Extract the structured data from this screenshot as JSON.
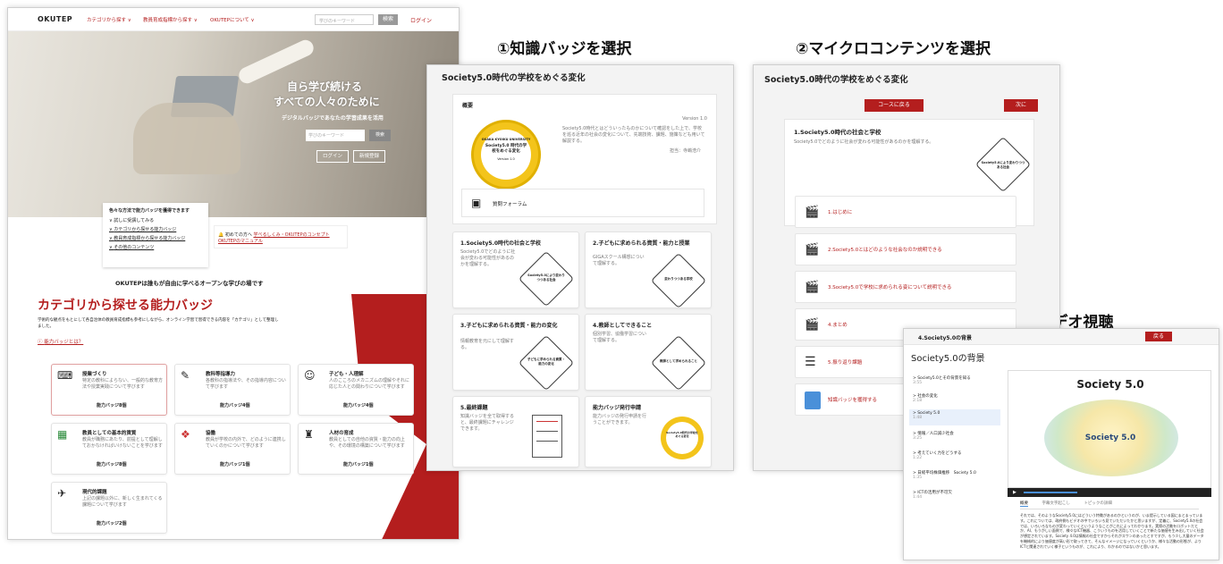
{
  "steps": {
    "s1": "①知識バッジを選択",
    "s2": "②マイクロコンテンツを選択",
    "s3": "③ビデオ視聴"
  },
  "home": {
    "logo": "OKUTEP",
    "nav": [
      "カテゴリから探す ∨",
      "教員育成指標から探す ∨",
      "OKUTEPについて ∨"
    ],
    "search_placeholder": "学びのキーワード",
    "search_btn": "検索",
    "login": "ログイン",
    "hero_title1": "自ら学び続ける",
    "hero_title2": "すべての人々のために",
    "hero_sub": "デジタルバッジであなたの学習成果を活用",
    "hero_search_placeholder": "学びのキーワード",
    "hero_search_btn": "検索",
    "hero_login": "ログイン",
    "hero_register": "新規登録",
    "ways_title": "色々な方法で能力バッジを獲得できます",
    "ways": [
      "試しに受講してみる",
      "カテゴリから探せる能力バッジ",
      "教員育成指標から探せる能力バッジ",
      "その他のコンテンツ"
    ],
    "first_time": "初めての方へ",
    "first_links": "学べるしくみ・OKUTEPのコンセプト OKUTEPのマニュアル",
    "tagline": "OKUTEPは誰もが自由に学べるオープンな学びの場です",
    "cat_title": "カテゴリから探せる能力バッジ",
    "cat_desc": "学術的な観点をもとにして各自治体の教員育成指標も参考にしながら、オンライン学習で習得できる内容を「カテゴリ」として整理しました。",
    "what_badge": "能力バッジとは？",
    "categories": [
      {
        "name": "授業づくり",
        "desc": "特定の教科によらない、一般的な教育方法や授業実践について学びます",
        "count": "能力バッジ8個"
      },
      {
        "name": "教科等指導力",
        "desc": "各教科の指導法や、その指導内容について学びます",
        "count": "能力バッジ4個"
      },
      {
        "name": "子ども・人理解",
        "desc": "人のこころのメカニズムの理解やそれに応じた人との関わりについて学びます",
        "count": "能力バッジ4個"
      },
      {
        "name": "教員としての基本的資質",
        "desc": "教員が職務にあたり、前提として理解しておかなければいけないことを学びます",
        "count": "能力バッジ8個"
      },
      {
        "name": "協働",
        "desc": "教員が学校の内外で、どのように連携していくのかについて学びます",
        "count": "能力バッジ1個"
      },
      {
        "name": "人材の育成",
        "desc": "教員としての自他の資質・能力の向上や、その環境の構築について学びます",
        "count": "能力バッジ1個"
      },
      {
        "name": "現代的課題",
        "desc": "上記の課題以外に、新しく生まれてくる課題について学びます",
        "count": "能力バッジ2個"
      }
    ]
  },
  "badge": {
    "title": "Society5.0時代の学校をめぐる変化",
    "overview": "概要",
    "version": "Version 1.0",
    "medal_univ": "OSAKA KYOIKU UNIVERSITY",
    "medal_title": "Society5.0 時代の学校をめぐる変化",
    "medal_version": "Version 1.0",
    "desc": "Society5.0時代とはどういったものかについて確認をした上で、学校を巡る近年の社会の変化について、先端技術、課題、施策なども用いて解説する。",
    "author": "担当：寺嶋浩介",
    "forum": "質問フォーラム",
    "cards": [
      {
        "title": "1.Society5.0時代の社会と学校",
        "desc": "Society5.0でどのように社会が変わる可能性があるのかを理解する。",
        "hex": "Society5.0により変わりつつある社会"
      },
      {
        "title": "2.子どもに求められる資質・能力と授業",
        "desc": "GIGAスクール構想について理解する。",
        "hex": "変わりつつある学校"
      },
      {
        "title": "3.子どもに求められる資質・能力の変化",
        "desc": "情報教育を元にして理解する。",
        "hex": "子どもに求められる資質・能力の変化"
      },
      {
        "title": "4.教師としてできること",
        "desc": "個別学習、協働学習について理解する。",
        "hex": "教師として求められること"
      },
      {
        "title": "5.最終課題",
        "desc": "知識バッジを全て取得すると、最終課題にチャレンジできます。",
        "hex": "Society5.0時代の学校をめぐる変化"
      },
      {
        "title": "能力バッジ発行申請",
        "desc": "能力バッジの発行申請を行うことができます。",
        "hex": "Society5.0時代の学校をめぐる変化"
      }
    ]
  },
  "micro": {
    "title": "Society5.0時代の学校をめぐる変化",
    "back": "コースに戻る",
    "next": "次に",
    "section": "1.Society5.0時代の社会と学校",
    "section_desc": "Society5.0でどのように社会が変わる可能性があるのかを理解する。",
    "hex": "Society5.0により変わりつつある社会",
    "items": [
      "1.はじめに",
      "2.Society5.0とはどのような社会なのか説明できる",
      "3.Society5.0で学校に求められる姿について説明できる",
      "4.まとめ",
      "5.振り返り課題",
      "知識バッジを獲得する"
    ]
  },
  "video": {
    "header": "4.Society5.0の背景",
    "back": "戻る",
    "title": "Society5.0の背景",
    "chapters": [
      "Society5.0とその背景を知る",
      "社会の変化",
      "Society 5.0",
      "情報／人口減少社会",
      "考えていく力をどうする",
      "日経平均株価推移　Society 5.0",
      "ICTの活用が不可欠"
    ],
    "chapter_times": [
      "3:55",
      "2:18",
      "1:48",
      "3:25",
      "1:22",
      "1:35",
      "1:44"
    ],
    "slide_title": "Society 5.0",
    "slide_center": "Society 5.0",
    "tabs": [
      "概要",
      "字幕文字起こし",
      "トピックの詳細"
    ],
    "transcript": "それでは、そのようなSociety5.0にはどういう特徴があるのかというのが、いま提示している図にまとまっています。これについては、政府側もビデオの中でいろいろ見ていただいたかと思いますが、定義に、Society5.0の社会では、いろいろなものが変わっていくというようなことがこれによってわかります。実際の活動をロボットだとか、AI、もうがしい面倒で、様々なICT機器、こういうものを活用していくことで新たな価値を生み出していく社会が想定されています。Society 4.0は情報の社会ですからそれがスワンのあったとすですが、もう少し大量のデータを機械的により価値度が高い形で取ってきて、そんなイメージになっていくというか、様々な活動の形態が、よりICTと関連されていく様子というものが、これにより、わかるのではないかと思います。"
  }
}
